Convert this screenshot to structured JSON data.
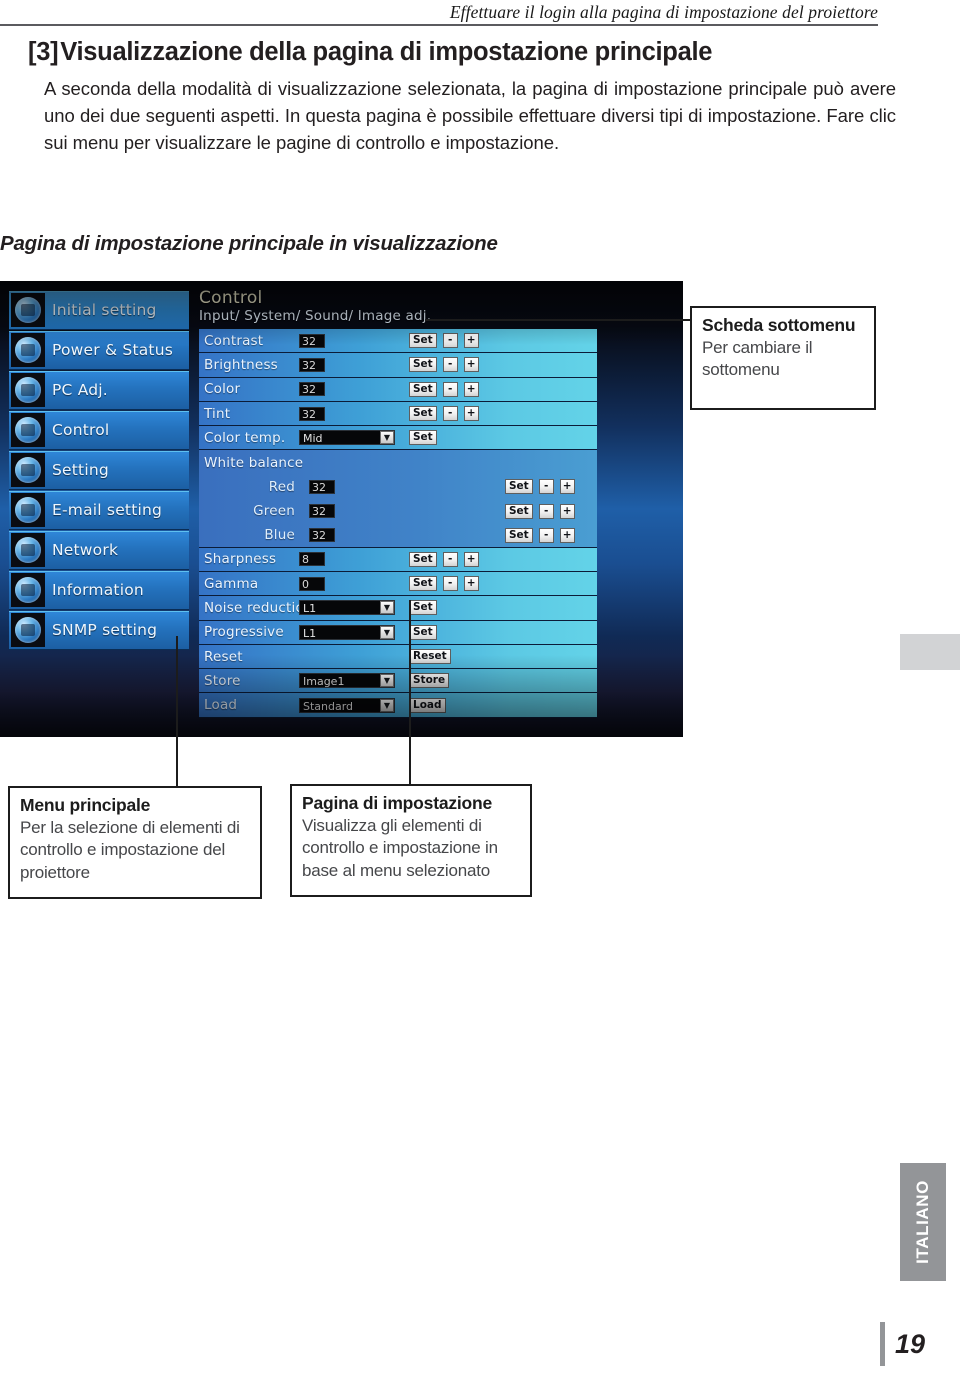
{
  "page": {
    "running_header": "Effettuare il login alla pagina di impostazione del proiettore",
    "section_number": "[3]",
    "section_title": "Visualizzazione della pagina di impostazione principale",
    "intro_paragraph": "A seconda della modalità di visualizzazione selezionata, la pagina di impostazione principale può avere uno dei due seguenti aspetti. In questa pagina è possibile effettuare diversi tipi di impostazione. Fare clic sui menu per visualizzare le pagine di controllo e impostazione.",
    "sub_heading": "Pagina di impostazione principale in visualizzazione",
    "language_tab": "ITALIANO",
    "folio": "19"
  },
  "callouts": {
    "submenu": {
      "title": "Scheda sottomenu",
      "body": "Per cambiare il sottomenu"
    },
    "main_menu": {
      "title": "Menu principale",
      "body": "Per la selezione di elementi di controllo e impostazione del proiettore"
    },
    "setting_page": {
      "title": "Pagina di impostazione",
      "body": "Visualizza gli elementi di controllo e impostazione in base al menu selezionato"
    }
  },
  "projector_ui": {
    "menu": {
      "items": [
        {
          "label": "Initial setting",
          "icon": "initial-setting-icon",
          "selected": true
        },
        {
          "label": "Power & Status",
          "icon": "power-status-icon",
          "selected": false
        },
        {
          "label": "PC Adj.",
          "icon": "pc-adj-icon",
          "selected": false
        },
        {
          "label": "Control",
          "icon": "control-icon",
          "selected": false
        },
        {
          "label": "Setting",
          "icon": "setting-icon",
          "selected": false
        },
        {
          "label": "E-mail setting",
          "icon": "email-setting-icon",
          "selected": false
        },
        {
          "label": "Network",
          "icon": "network-icon",
          "selected": false
        },
        {
          "label": "Information",
          "icon": "information-icon",
          "selected": false
        },
        {
          "label": "SNMP setting",
          "icon": "snmp-setting-icon",
          "selected": false
        }
      ]
    },
    "panel": {
      "title": "Control",
      "submenu_tabs": "Input/ System/ Sound/ Image adj.",
      "rows": [
        {
          "label": "Contrast",
          "value": "32",
          "control": "text",
          "buttons": [
            "Set",
            "-",
            "+"
          ]
        },
        {
          "label": "Brightness",
          "value": "32",
          "control": "text",
          "buttons": [
            "Set",
            "-",
            "+"
          ]
        },
        {
          "label": "Color",
          "value": "32",
          "control": "text",
          "buttons": [
            "Set",
            "-",
            "+"
          ]
        },
        {
          "label": "Tint",
          "value": "32",
          "control": "text",
          "buttons": [
            "Set",
            "-",
            "+"
          ]
        },
        {
          "label": "Color temp.",
          "value": "Mid",
          "control": "select",
          "buttons": [
            "Set"
          ]
        },
        {
          "label": "White balance",
          "value": "",
          "control": "none",
          "buttons": []
        },
        {
          "label": "Red",
          "value": "32",
          "control": "text",
          "buttons": [
            "Set",
            "-",
            "+"
          ],
          "indent": true
        },
        {
          "label": "Green",
          "value": "32",
          "control": "text",
          "buttons": [
            "Set",
            "-",
            "+"
          ],
          "indent": true
        },
        {
          "label": "Blue",
          "value": "32",
          "control": "text",
          "buttons": [
            "Set",
            "-",
            "+"
          ],
          "indent": true
        },
        {
          "label": "Sharpness",
          "value": "8",
          "control": "text",
          "buttons": [
            "Set",
            "-",
            "+"
          ]
        },
        {
          "label": "Gamma",
          "value": "0",
          "control": "text",
          "buttons": [
            "Set",
            "-",
            "+"
          ]
        },
        {
          "label": "Noise reduction",
          "value": "L1",
          "control": "select",
          "buttons": [
            "Set"
          ]
        },
        {
          "label": "Progressive",
          "value": "L1",
          "control": "select",
          "buttons": [
            "Set"
          ]
        },
        {
          "label": "Reset",
          "value": "",
          "control": "none",
          "buttons": [
            "Reset"
          ]
        },
        {
          "label": "Store",
          "value": "Image1",
          "control": "select",
          "buttons": [
            "Store"
          ]
        },
        {
          "label": "Load",
          "value": "Standard",
          "control": "select",
          "buttons": [
            "Load"
          ]
        }
      ]
    }
  }
}
